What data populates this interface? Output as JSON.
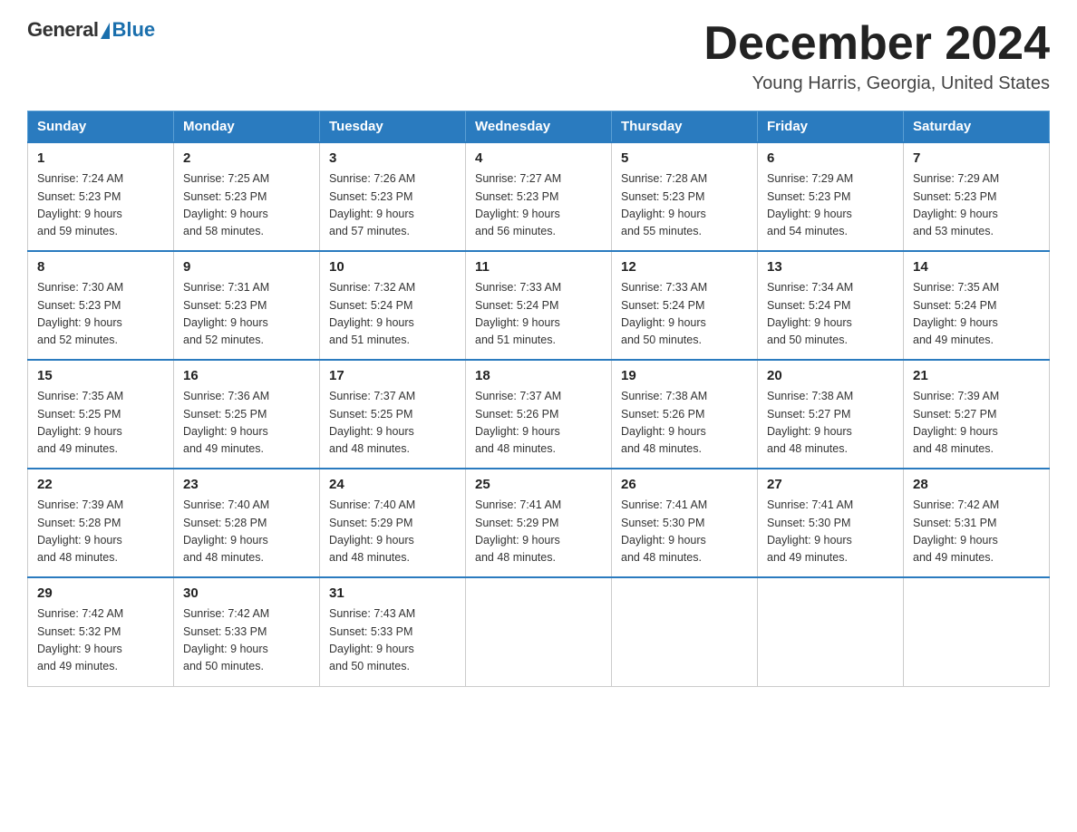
{
  "header": {
    "logo": {
      "general": "General",
      "blue": "Blue"
    },
    "title": "December 2024",
    "location": "Young Harris, Georgia, United States"
  },
  "days_of_week": [
    "Sunday",
    "Monday",
    "Tuesday",
    "Wednesday",
    "Thursday",
    "Friday",
    "Saturday"
  ],
  "weeks": [
    [
      {
        "day": "1",
        "sunrise": "7:24 AM",
        "sunset": "5:23 PM",
        "daylight": "9 hours and 59 minutes."
      },
      {
        "day": "2",
        "sunrise": "7:25 AM",
        "sunset": "5:23 PM",
        "daylight": "9 hours and 58 minutes."
      },
      {
        "day": "3",
        "sunrise": "7:26 AM",
        "sunset": "5:23 PM",
        "daylight": "9 hours and 57 minutes."
      },
      {
        "day": "4",
        "sunrise": "7:27 AM",
        "sunset": "5:23 PM",
        "daylight": "9 hours and 56 minutes."
      },
      {
        "day": "5",
        "sunrise": "7:28 AM",
        "sunset": "5:23 PM",
        "daylight": "9 hours and 55 minutes."
      },
      {
        "day": "6",
        "sunrise": "7:29 AM",
        "sunset": "5:23 PM",
        "daylight": "9 hours and 54 minutes."
      },
      {
        "day": "7",
        "sunrise": "7:29 AM",
        "sunset": "5:23 PM",
        "daylight": "9 hours and 53 minutes."
      }
    ],
    [
      {
        "day": "8",
        "sunrise": "7:30 AM",
        "sunset": "5:23 PM",
        "daylight": "9 hours and 52 minutes."
      },
      {
        "day": "9",
        "sunrise": "7:31 AM",
        "sunset": "5:23 PM",
        "daylight": "9 hours and 52 minutes."
      },
      {
        "day": "10",
        "sunrise": "7:32 AM",
        "sunset": "5:24 PM",
        "daylight": "9 hours and 51 minutes."
      },
      {
        "day": "11",
        "sunrise": "7:33 AM",
        "sunset": "5:24 PM",
        "daylight": "9 hours and 51 minutes."
      },
      {
        "day": "12",
        "sunrise": "7:33 AM",
        "sunset": "5:24 PM",
        "daylight": "9 hours and 50 minutes."
      },
      {
        "day": "13",
        "sunrise": "7:34 AM",
        "sunset": "5:24 PM",
        "daylight": "9 hours and 50 minutes."
      },
      {
        "day": "14",
        "sunrise": "7:35 AM",
        "sunset": "5:24 PM",
        "daylight": "9 hours and 49 minutes."
      }
    ],
    [
      {
        "day": "15",
        "sunrise": "7:35 AM",
        "sunset": "5:25 PM",
        "daylight": "9 hours and 49 minutes."
      },
      {
        "day": "16",
        "sunrise": "7:36 AM",
        "sunset": "5:25 PM",
        "daylight": "9 hours and 49 minutes."
      },
      {
        "day": "17",
        "sunrise": "7:37 AM",
        "sunset": "5:25 PM",
        "daylight": "9 hours and 48 minutes."
      },
      {
        "day": "18",
        "sunrise": "7:37 AM",
        "sunset": "5:26 PM",
        "daylight": "9 hours and 48 minutes."
      },
      {
        "day": "19",
        "sunrise": "7:38 AM",
        "sunset": "5:26 PM",
        "daylight": "9 hours and 48 minutes."
      },
      {
        "day": "20",
        "sunrise": "7:38 AM",
        "sunset": "5:27 PM",
        "daylight": "9 hours and 48 minutes."
      },
      {
        "day": "21",
        "sunrise": "7:39 AM",
        "sunset": "5:27 PM",
        "daylight": "9 hours and 48 minutes."
      }
    ],
    [
      {
        "day": "22",
        "sunrise": "7:39 AM",
        "sunset": "5:28 PM",
        "daylight": "9 hours and 48 minutes."
      },
      {
        "day": "23",
        "sunrise": "7:40 AM",
        "sunset": "5:28 PM",
        "daylight": "9 hours and 48 minutes."
      },
      {
        "day": "24",
        "sunrise": "7:40 AM",
        "sunset": "5:29 PM",
        "daylight": "9 hours and 48 minutes."
      },
      {
        "day": "25",
        "sunrise": "7:41 AM",
        "sunset": "5:29 PM",
        "daylight": "9 hours and 48 minutes."
      },
      {
        "day": "26",
        "sunrise": "7:41 AM",
        "sunset": "5:30 PM",
        "daylight": "9 hours and 48 minutes."
      },
      {
        "day": "27",
        "sunrise": "7:41 AM",
        "sunset": "5:30 PM",
        "daylight": "9 hours and 49 minutes."
      },
      {
        "day": "28",
        "sunrise": "7:42 AM",
        "sunset": "5:31 PM",
        "daylight": "9 hours and 49 minutes."
      }
    ],
    [
      {
        "day": "29",
        "sunrise": "7:42 AM",
        "sunset": "5:32 PM",
        "daylight": "9 hours and 49 minutes."
      },
      {
        "day": "30",
        "sunrise": "7:42 AM",
        "sunset": "5:33 PM",
        "daylight": "9 hours and 50 minutes."
      },
      {
        "day": "31",
        "sunrise": "7:43 AM",
        "sunset": "5:33 PM",
        "daylight": "9 hours and 50 minutes."
      },
      null,
      null,
      null,
      null
    ]
  ],
  "labels": {
    "sunrise": "Sunrise:",
    "sunset": "Sunset:",
    "daylight": "Daylight: 9 hours"
  }
}
